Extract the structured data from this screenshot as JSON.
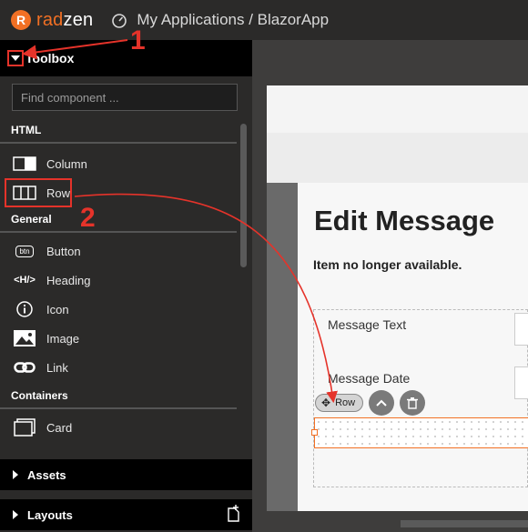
{
  "header": {
    "logo_text_a": "rad",
    "logo_text_b": "zen",
    "breadcrumb": "My Applications / BlazorApp"
  },
  "toolbox": {
    "title": "Toolbox",
    "search_placeholder": "Find component ...",
    "sections": {
      "html": "HTML",
      "general": "General",
      "containers": "Containers"
    },
    "html_items": [
      "Column",
      "Row"
    ],
    "general_items": [
      "Button",
      "Heading",
      "Icon",
      "Image",
      "Link"
    ],
    "container_items": [
      "Card"
    ],
    "bottom": [
      "Assets",
      "Layouts"
    ],
    "button_icon_text": "btn",
    "heading_icon_text": "<H/>"
  },
  "page": {
    "title": "Edit Message",
    "notice": "Item no longer available.",
    "label_message_text": "Message Text",
    "label_message_date": "Message Date",
    "row_chip_label": "Row"
  },
  "annotations": {
    "step1": "1",
    "step2": "2"
  },
  "colors": {
    "accent": "#f27024",
    "annotation": "#e5332a"
  }
}
